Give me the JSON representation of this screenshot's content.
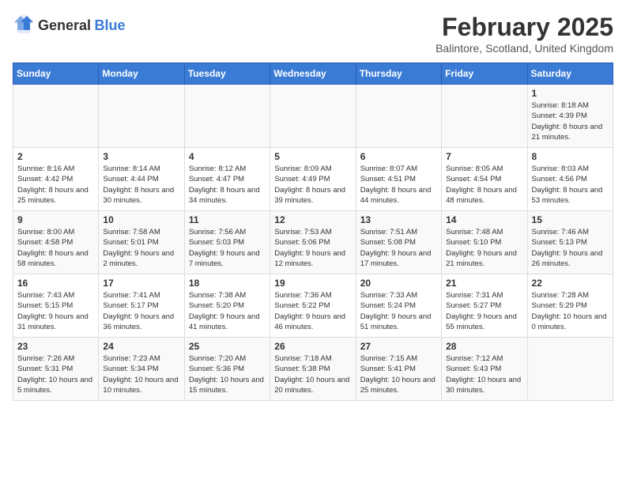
{
  "header": {
    "logo_general": "General",
    "logo_blue": "Blue",
    "title": "February 2025",
    "subtitle": "Balintore, Scotland, United Kingdom"
  },
  "calendar": {
    "days_of_week": [
      "Sunday",
      "Monday",
      "Tuesday",
      "Wednesday",
      "Thursday",
      "Friday",
      "Saturday"
    ],
    "weeks": [
      [
        {
          "day": "",
          "info": ""
        },
        {
          "day": "",
          "info": ""
        },
        {
          "day": "",
          "info": ""
        },
        {
          "day": "",
          "info": ""
        },
        {
          "day": "",
          "info": ""
        },
        {
          "day": "",
          "info": ""
        },
        {
          "day": "1",
          "info": "Sunrise: 8:18 AM\nSunset: 4:39 PM\nDaylight: 8 hours and 21 minutes."
        }
      ],
      [
        {
          "day": "2",
          "info": "Sunrise: 8:16 AM\nSunset: 4:42 PM\nDaylight: 8 hours and 25 minutes."
        },
        {
          "day": "3",
          "info": "Sunrise: 8:14 AM\nSunset: 4:44 PM\nDaylight: 8 hours and 30 minutes."
        },
        {
          "day": "4",
          "info": "Sunrise: 8:12 AM\nSunset: 4:47 PM\nDaylight: 8 hours and 34 minutes."
        },
        {
          "day": "5",
          "info": "Sunrise: 8:09 AM\nSunset: 4:49 PM\nDaylight: 8 hours and 39 minutes."
        },
        {
          "day": "6",
          "info": "Sunrise: 8:07 AM\nSunset: 4:51 PM\nDaylight: 8 hours and 44 minutes."
        },
        {
          "day": "7",
          "info": "Sunrise: 8:05 AM\nSunset: 4:54 PM\nDaylight: 8 hours and 48 minutes."
        },
        {
          "day": "8",
          "info": "Sunrise: 8:03 AM\nSunset: 4:56 PM\nDaylight: 8 hours and 53 minutes."
        }
      ],
      [
        {
          "day": "9",
          "info": "Sunrise: 8:00 AM\nSunset: 4:58 PM\nDaylight: 8 hours and 58 minutes."
        },
        {
          "day": "10",
          "info": "Sunrise: 7:58 AM\nSunset: 5:01 PM\nDaylight: 9 hours and 2 minutes."
        },
        {
          "day": "11",
          "info": "Sunrise: 7:56 AM\nSunset: 5:03 PM\nDaylight: 9 hours and 7 minutes."
        },
        {
          "day": "12",
          "info": "Sunrise: 7:53 AM\nSunset: 5:06 PM\nDaylight: 9 hours and 12 minutes."
        },
        {
          "day": "13",
          "info": "Sunrise: 7:51 AM\nSunset: 5:08 PM\nDaylight: 9 hours and 17 minutes."
        },
        {
          "day": "14",
          "info": "Sunrise: 7:48 AM\nSunset: 5:10 PM\nDaylight: 9 hours and 21 minutes."
        },
        {
          "day": "15",
          "info": "Sunrise: 7:46 AM\nSunset: 5:13 PM\nDaylight: 9 hours and 26 minutes."
        }
      ],
      [
        {
          "day": "16",
          "info": "Sunrise: 7:43 AM\nSunset: 5:15 PM\nDaylight: 9 hours and 31 minutes."
        },
        {
          "day": "17",
          "info": "Sunrise: 7:41 AM\nSunset: 5:17 PM\nDaylight: 9 hours and 36 minutes."
        },
        {
          "day": "18",
          "info": "Sunrise: 7:38 AM\nSunset: 5:20 PM\nDaylight: 9 hours and 41 minutes."
        },
        {
          "day": "19",
          "info": "Sunrise: 7:36 AM\nSunset: 5:22 PM\nDaylight: 9 hours and 46 minutes."
        },
        {
          "day": "20",
          "info": "Sunrise: 7:33 AM\nSunset: 5:24 PM\nDaylight: 9 hours and 51 minutes."
        },
        {
          "day": "21",
          "info": "Sunrise: 7:31 AM\nSunset: 5:27 PM\nDaylight: 9 hours and 55 minutes."
        },
        {
          "day": "22",
          "info": "Sunrise: 7:28 AM\nSunset: 5:29 PM\nDaylight: 10 hours and 0 minutes."
        }
      ],
      [
        {
          "day": "23",
          "info": "Sunrise: 7:26 AM\nSunset: 5:31 PM\nDaylight: 10 hours and 5 minutes."
        },
        {
          "day": "24",
          "info": "Sunrise: 7:23 AM\nSunset: 5:34 PM\nDaylight: 10 hours and 10 minutes."
        },
        {
          "day": "25",
          "info": "Sunrise: 7:20 AM\nSunset: 5:36 PM\nDaylight: 10 hours and 15 minutes."
        },
        {
          "day": "26",
          "info": "Sunrise: 7:18 AM\nSunset: 5:38 PM\nDaylight: 10 hours and 20 minutes."
        },
        {
          "day": "27",
          "info": "Sunrise: 7:15 AM\nSunset: 5:41 PM\nDaylight: 10 hours and 25 minutes."
        },
        {
          "day": "28",
          "info": "Sunrise: 7:12 AM\nSunset: 5:43 PM\nDaylight: 10 hours and 30 minutes."
        },
        {
          "day": "",
          "info": ""
        }
      ]
    ]
  }
}
